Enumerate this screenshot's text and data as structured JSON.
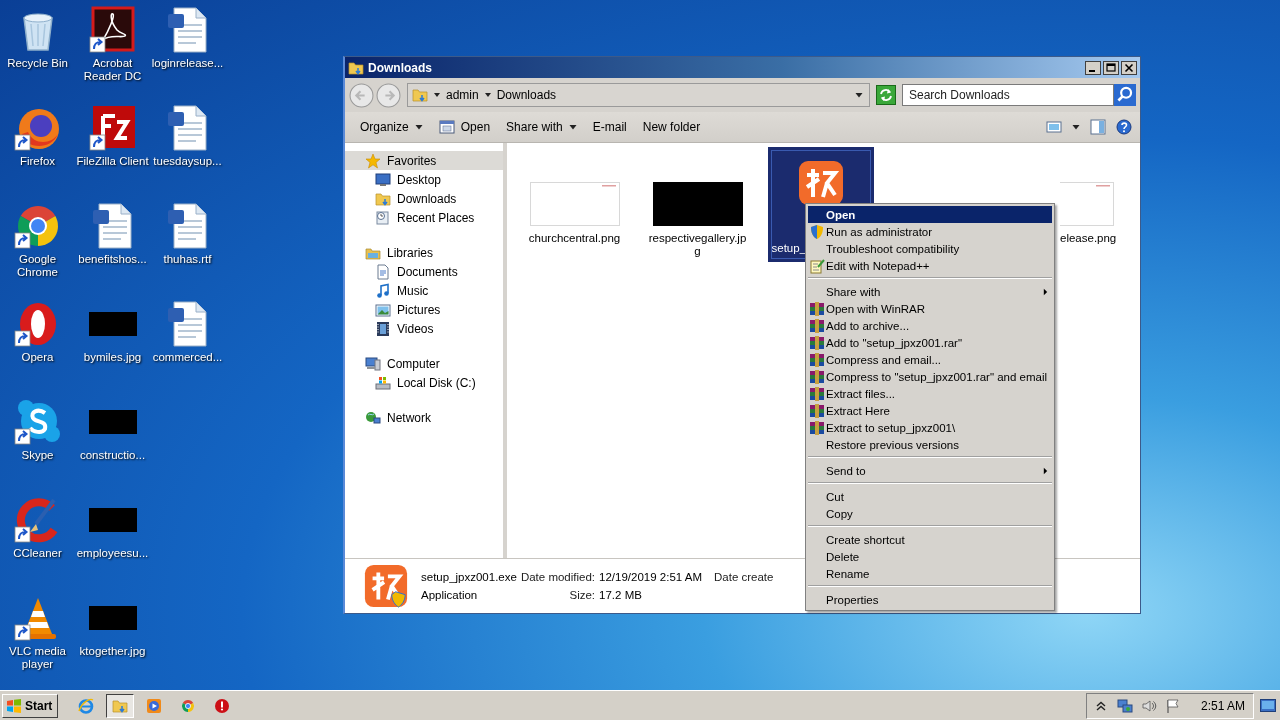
{
  "desktop": {
    "columns": [
      {
        "icons": [
          {
            "label": "Recycle Bin",
            "kind": "recycle",
            "shortcut": false
          },
          {
            "label": "Firefox",
            "kind": "firefox",
            "shortcut": true
          },
          {
            "label": "Google Chrome",
            "kind": "chrome",
            "shortcut": true
          },
          {
            "label": "Opera",
            "kind": "opera",
            "shortcut": true
          },
          {
            "label": "Skype",
            "kind": "skype",
            "shortcut": true
          },
          {
            "label": "CCleaner",
            "kind": "ccleaner",
            "shortcut": true
          },
          {
            "label": "VLC media player",
            "kind": "vlc",
            "shortcut": true
          }
        ]
      },
      {
        "icons": [
          {
            "label": "Acrobat Reader DC",
            "kind": "pdf",
            "shortcut": true
          },
          {
            "label": "FileZilla Client",
            "kind": "filezilla",
            "shortcut": true
          },
          {
            "label": "benefitshos...",
            "kind": "word",
            "shortcut": false
          },
          {
            "label": "bymiles.jpg",
            "kind": "thumb",
            "shortcut": false
          },
          {
            "label": "constructio...",
            "kind": "thumb",
            "shortcut": false
          },
          {
            "label": "employeesu...",
            "kind": "thumb",
            "shortcut": false
          },
          {
            "label": "ktogether.jpg",
            "kind": "thumb",
            "shortcut": false
          }
        ]
      },
      {
        "icons": [
          {
            "label": "loginrelease...",
            "kind": "word",
            "shortcut": false
          },
          {
            "label": "tuesdaysup...",
            "kind": "word",
            "shortcut": false
          },
          {
            "label": "thuhas.rtf",
            "kind": "word",
            "shortcut": false
          },
          {
            "label": "commerced...",
            "kind": "word",
            "shortcut": false
          }
        ]
      }
    ]
  },
  "window": {
    "title": "Downloads",
    "breadcrumb": [
      "admin",
      "Downloads"
    ],
    "search": {
      "placeholder": "Search Downloads"
    },
    "toolbar": [
      {
        "label": "Organize",
        "dropdown": true
      },
      {
        "label": "Open",
        "dropdown": false
      },
      {
        "label": "Share with",
        "dropdown": true
      },
      {
        "label": "E-mail",
        "dropdown": false
      },
      {
        "label": "New folder",
        "dropdown": false
      }
    ],
    "nav": [
      {
        "label": "Favorites",
        "selected": true,
        "children": [
          {
            "label": "Desktop",
            "selected": false
          },
          {
            "label": "Downloads",
            "selected": false
          },
          {
            "label": "Recent Places",
            "selected": false
          }
        ]
      },
      {
        "label": "Libraries",
        "selected": false,
        "children": [
          {
            "label": "Documents",
            "selected": false
          },
          {
            "label": "Music",
            "selected": false
          },
          {
            "label": "Pictures",
            "selected": false
          },
          {
            "label": "Videos",
            "selected": false
          }
        ]
      },
      {
        "label": "Computer",
        "selected": false,
        "children": [
          {
            "label": "Local Disk (C:)",
            "selected": false
          }
        ]
      },
      {
        "label": "Network",
        "selected": false
      }
    ],
    "files": [
      {
        "name": "churchcentral.png",
        "kind": "white",
        "selected": false
      },
      {
        "name": "respectivegallery.jpg",
        "kind": "black",
        "selected": false
      },
      {
        "name": "setup_",
        "kind": "app",
        "selected": true
      },
      {
        "name": "elease.png",
        "kind": "white",
        "selected": false
      }
    ],
    "details": {
      "name": "setup_jpxz001.exe",
      "type": "Application",
      "modified_label": "Date modified:",
      "modified": "12/19/2019 2:51 AM",
      "size_label": "Size:",
      "size": "17.2 MB",
      "created_label": "Date create"
    }
  },
  "context_menu": {
    "items": [
      {
        "kind": "item",
        "label": "Open",
        "submenu": false,
        "default": true,
        "selected": true
      },
      {
        "kind": "item",
        "label": "Run as administrator",
        "submenu": false,
        "default": false,
        "selected": false
      },
      {
        "kind": "item",
        "label": "Troubleshoot compatibility",
        "submenu": false,
        "default": false,
        "selected": false
      },
      {
        "kind": "item",
        "label": "Edit with Notepad++",
        "submenu": false,
        "default": false,
        "selected": false
      },
      {
        "kind": "separator"
      },
      {
        "kind": "item",
        "label": "Share with",
        "submenu": true,
        "default": false,
        "selected": false
      },
      {
        "kind": "item",
        "label": "Open with WinRAR",
        "submenu": false,
        "default": false,
        "selected": false
      },
      {
        "kind": "item",
        "label": "Add to archive...",
        "submenu": false,
        "default": false,
        "selected": false
      },
      {
        "kind": "item",
        "label": "Add to \"setup_jpxz001.rar\"",
        "submenu": false,
        "default": false,
        "selected": false
      },
      {
        "kind": "item",
        "label": "Compress and email...",
        "submenu": false,
        "default": false,
        "selected": false
      },
      {
        "kind": "item",
        "label": "Compress to \"setup_jpxz001.rar\" and email",
        "submenu": false,
        "default": false,
        "selected": false
      },
      {
        "kind": "item",
        "label": "Extract files...",
        "submenu": false,
        "default": false,
        "selected": false
      },
      {
        "kind": "item",
        "label": "Extract Here",
        "submenu": false,
        "default": false,
        "selected": false
      },
      {
        "kind": "item",
        "label": "Extract to setup_jpxz001\\",
        "submenu": false,
        "default": false,
        "selected": false
      },
      {
        "kind": "item",
        "label": "Restore previous versions",
        "submenu": false,
        "default": false,
        "selected": false
      },
      {
        "kind": "separator"
      },
      {
        "kind": "item",
        "label": "Send to",
        "submenu": true,
        "default": false,
        "selected": false
      },
      {
        "kind": "separator"
      },
      {
        "kind": "item",
        "label": "Cut",
        "submenu": false,
        "default": false,
        "selected": false
      },
      {
        "kind": "item",
        "label": "Copy",
        "submenu": false,
        "default": false,
        "selected": false
      },
      {
        "kind": "separator"
      },
      {
        "kind": "item",
        "label": "Create shortcut",
        "submenu": false,
        "default": false,
        "selected": false
      },
      {
        "kind": "item",
        "label": "Delete",
        "submenu": false,
        "default": false,
        "selected": false
      },
      {
        "kind": "item",
        "label": "Rename",
        "submenu": false,
        "default": false,
        "selected": false
      },
      {
        "kind": "separator"
      },
      {
        "kind": "item",
        "label": "Properties",
        "submenu": false,
        "default": false,
        "selected": false
      }
    ]
  },
  "taskbar": {
    "start": "Start",
    "apps": [
      {
        "kind": "ie",
        "selected": false
      },
      {
        "kind": "explorer",
        "selected": true
      },
      {
        "kind": "media",
        "selected": false
      },
      {
        "kind": "chrome",
        "selected": false
      },
      {
        "kind": "opera",
        "selected": false
      }
    ],
    "clock": "2:51 AM"
  }
}
